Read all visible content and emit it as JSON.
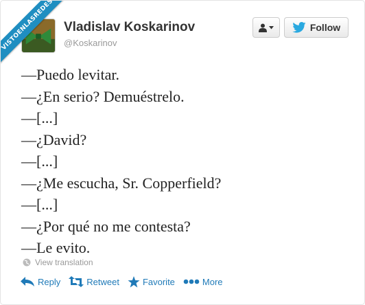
{
  "ribbon": {
    "text": "VISTOENLASREDES"
  },
  "colors": {
    "accent": "#1f7ab8",
    "ribbon": "#1f8ec1",
    "twitter_blue": "#2aa9e0"
  },
  "header": {
    "name": "Vladislav Koskarinov",
    "handle": "@Koskarinov",
    "user_menu_icon": "person-icon",
    "follow_label": "Follow"
  },
  "tweet": {
    "lines": [
      "—Puedo levitar.",
      "—¿En serio? Demuéstrelo.",
      "—[...]",
      "—¿David?",
      "—[...]",
      "—¿Me escucha, Sr. Copperfield?",
      "—[...]",
      "—¿Por qué no me contesta?",
      "—Le evito."
    ]
  },
  "translation": {
    "label": "View translation",
    "icon": "globe-icon"
  },
  "actions": {
    "reply": "Reply",
    "retweet": "Retweet",
    "favorite": "Favorite",
    "more": "More"
  }
}
